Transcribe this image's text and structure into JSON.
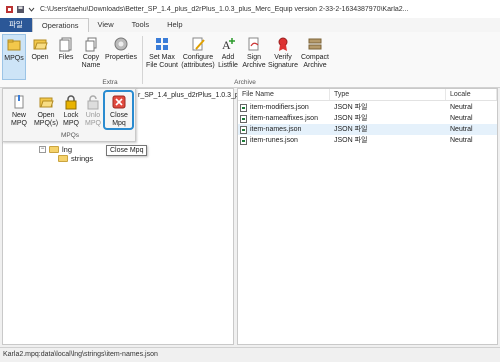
{
  "window": {
    "title": "C:\\Users\\taehu\\Downloads\\Better_SP_1.4_plus_d2rPlus_1.0.3_plus_Merc_Equip version 2-33-2-1634387970\\Karla2..."
  },
  "menu_tabs": [
    {
      "label": "파일"
    },
    {
      "label": "Operations"
    },
    {
      "label": "View"
    },
    {
      "label": "Tools"
    },
    {
      "label": "Help"
    }
  ],
  "ribbon": {
    "mpqs": "MPQs",
    "open": "Open",
    "files": "Files",
    "copy_name": [
      "Copy",
      "Name"
    ],
    "properties": "Properties",
    "extra_label": "Extra",
    "set_max": [
      "Set Max",
      "File Count"
    ],
    "configure": [
      "Configure",
      "(attributes)"
    ],
    "add_listfile": [
      "Add",
      "Listfile"
    ],
    "sign_archive": [
      "Sign",
      "Archive"
    ],
    "verify_signature": [
      "Verify",
      "Signature"
    ],
    "compact_archive": [
      "Compact",
      "Archive"
    ],
    "archive_label": "Archive"
  },
  "mpq_dropdown": {
    "new": [
      "New",
      "MPQ"
    ],
    "open": [
      "Open",
      "MPQ(s)"
    ],
    "lock": [
      "Lock",
      "MPQ"
    ],
    "unlock": [
      "Unlo",
      "MPQ"
    ],
    "close": [
      "Close",
      "Mpq"
    ],
    "group_label": "MPQs"
  },
  "tree": {
    "root_path_fragment": "r_SP_1.4_plus_d2rPlus_1.0.3_pl",
    "lng": "lng",
    "strings": "strings"
  },
  "tooltip": "Close Mpq",
  "file_list": {
    "headers": {
      "name": "File Name",
      "type": "Type",
      "locale": "Locale"
    },
    "rows": [
      {
        "name": "item-modifiers.json",
        "type": "JSON 파일",
        "locale": "Neutral",
        "selected": false
      },
      {
        "name": "item-nameaffixes.json",
        "type": "JSON 파일",
        "locale": "Neutral",
        "selected": false
      },
      {
        "name": "item-names.json",
        "type": "JSON 파일",
        "locale": "Neutral",
        "selected": true
      },
      {
        "name": "item-runes.json",
        "type": "JSON 파일",
        "locale": "Neutral",
        "selected": false
      }
    ]
  },
  "status": "Karla2.mpq:data\\local\\lng\\strings\\item-names.json",
  "colors": {
    "accent": "#2b5797",
    "highlight": "#2a8bd0",
    "selected_row": "#e5f1fb"
  }
}
